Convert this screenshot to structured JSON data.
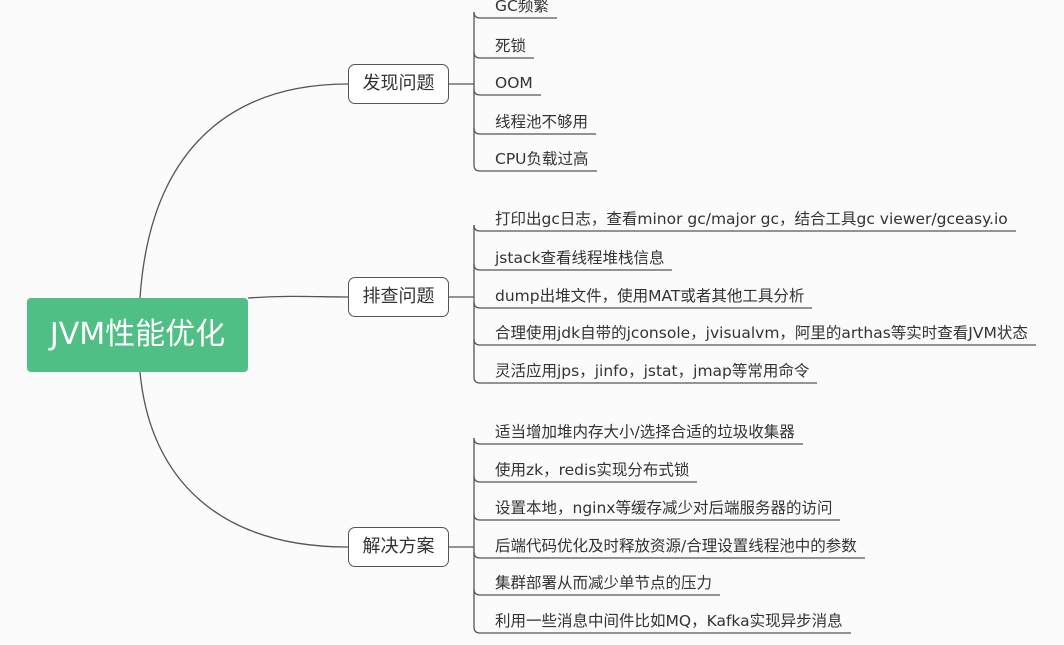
{
  "root": {
    "label": "JVM性能优化"
  },
  "branches": [
    {
      "label": "发现问题",
      "items": [
        "GC频繁",
        "死锁",
        "OOM",
        "线程池不够用",
        "CPU负载过高"
      ]
    },
    {
      "label": "排查问题",
      "items": [
        "打印出gc日志，查看minor gc/major gc，结合工具gc viewer/gceasy.io",
        "jstack查看线程堆栈信息",
        "dump出堆文件，使用MAT或者其他工具分析",
        "合理使用jdk自带的jconsole，jvisualvm，阿里的arthas等实时查看JVM状态",
        "灵活应用jps，jinfo，jstat，jmap等常用命令"
      ]
    },
    {
      "label": "解决方案",
      "items": [
        "适当增加堆内存大小/选择合适的垃圾收集器",
        "使用zk，redis实现分布式锁",
        "设置本地，nginx等缓存减少对后端服务器的访问",
        "后端代码优化及时释放资源/合理设置线程池中的参数",
        "集群部署从而减少单节点的压力",
        "利用一些消息中间件比如MQ，Kafka实现异步消息"
      ]
    }
  ],
  "colors": {
    "root_bg": "#4fbf85",
    "root_text": "#ffffff",
    "line": "#555555",
    "text": "#333333"
  }
}
